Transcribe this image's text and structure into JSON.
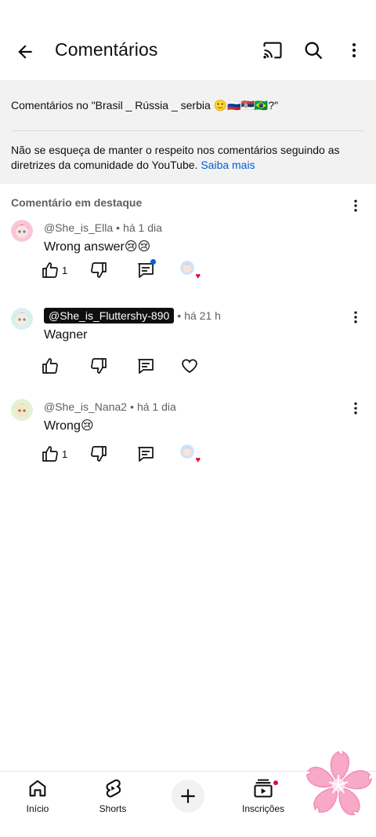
{
  "header": {
    "title": "Comentários",
    "back_icon": "arrow-left-icon",
    "cast_icon": "cast-icon",
    "search_icon": "search-icon",
    "more_icon": "more-vertical-icon"
  },
  "info": {
    "video_line": "Comentários no \"Brasil _ Rússia _ serbia  🙂🇷🇺🇷🇸🇧🇷?\"",
    "notice": "Não se esqueça de manter o respeito nos comentários seguindo as diretrizes da comunidade do YouTube.",
    "learn_more": "Saiba mais"
  },
  "pinned_label": "Comentário em destaque",
  "comments": [
    {
      "author": "@She_is_Ella",
      "time": "há 1 dia",
      "text": "Wrong answer😢😢",
      "likes": "1",
      "creator_heart": true,
      "reply_badge": true,
      "highlighted_author": false
    },
    {
      "author": "@She_is_Fluttershy-890",
      "time": "há 21 h",
      "text": "Wagner",
      "likes": "",
      "creator_heart": false,
      "reply_badge": false,
      "highlighted_author": true
    },
    {
      "author": "@She_is_Nana2",
      "time": "há 1 dia",
      "text": "Wrong😢",
      "likes": "1",
      "creator_heart": true,
      "reply_badge": false,
      "highlighted_author": false
    }
  ],
  "bottom_nav": {
    "home": "Início",
    "shorts": "Shorts",
    "create_icon": "plus-icon",
    "subscriptions": "Inscrições"
  },
  "colors": {
    "link": "#065fd4",
    "info_bg": "#f2f2f2",
    "heart": "#e00d3a",
    "text": "#0f0f0f",
    "muted": "#606060"
  }
}
